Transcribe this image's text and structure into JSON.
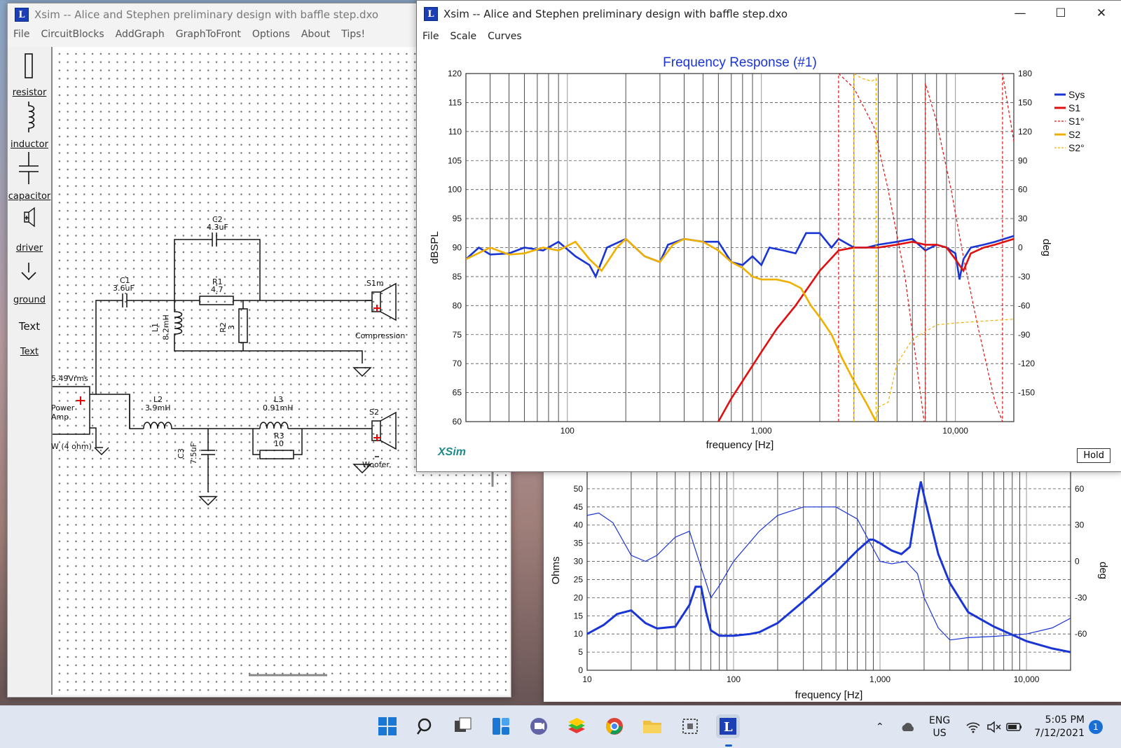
{
  "circuit_window": {
    "title": "Xsim -- Alice and Stephen preliminary design with baffle step.dxo",
    "menu": [
      "File",
      "CircuitBlocks",
      "AddGraph",
      "GraphToFront",
      "Options",
      "About",
      "Tips!"
    ],
    "palette": [
      "resistor",
      "inductor",
      "capacitor",
      "driver",
      "ground",
      "Text",
      "Text"
    ],
    "components": {
      "c1": [
        "C1",
        "3.6uF"
      ],
      "c2": [
        "C2",
        "4.3uF"
      ],
      "r1": [
        "R1",
        "4.7"
      ],
      "r2": [
        "R2",
        "3"
      ],
      "l1": [
        "L1",
        "8.2mH"
      ],
      "l2": [
        "L2",
        "3.9mH"
      ],
      "l3": [
        "L3",
        "0.91mH"
      ],
      "r3": [
        "R3",
        "10"
      ],
      "c3": [
        "C3",
        "7.5uF"
      ],
      "s1": [
        "S1m",
        "Compression"
      ],
      "s2": [
        "S2",
        "Woofer"
      ],
      "amp": [
        "5.49Vrms",
        "Power",
        "Amp.",
        "W (4 ohm)"
      ]
    }
  },
  "graph_window": {
    "title": "Xsim -- Alice and Stephen preliminary design with baffle step.dxo",
    "menu": [
      "File",
      "Scale",
      "Curves"
    ],
    "brand": "XSim",
    "hold": "Hold"
  },
  "chart_data": [
    {
      "type": "line",
      "title": "Frequency Response (#1)",
      "xlabel": "frequency [Hz]",
      "ylabel": "dBSPL",
      "y2label": "deg",
      "xscale": "log",
      "xlim": [
        30,
        20000
      ],
      "ylim": [
        60,
        120
      ],
      "y2lim": [
        -180,
        180
      ],
      "x_ticks": [
        "100",
        "1,000",
        "10,000"
      ],
      "y_ticks": [
        "120",
        "115",
        "110",
        "105",
        "100",
        "95",
        "90",
        "85",
        "80",
        "75",
        "70",
        "65",
        "60"
      ],
      "y2_ticks": [
        "180",
        "150",
        "120",
        "90",
        "60",
        "30",
        "0",
        "-30",
        "-60",
        "-90",
        "-120",
        "-150"
      ],
      "grid": true,
      "legend_position": "right",
      "series": [
        {
          "name": "Sys",
          "color": "#1a35d6",
          "dash": false,
          "axis": "left",
          "x": [
            30,
            35,
            40,
            50,
            60,
            75,
            90,
            110,
            130,
            140,
            160,
            200,
            250,
            300,
            330,
            400,
            500,
            600,
            700,
            800,
            900,
            1000,
            1100,
            1300,
            1500,
            1700,
            2000,
            2300,
            2500,
            3000,
            3500,
            4000,
            5000,
            6000,
            7000,
            8000,
            9000,
            10000,
            10500,
            11000,
            12000,
            14000,
            16000,
            20000
          ],
          "y": [
            88,
            90,
            88.8,
            89,
            90,
            89.5,
            91,
            88.5,
            87,
            85,
            90,
            91.5,
            88.5,
            87.5,
            90.5,
            91.5,
            91,
            91,
            87.5,
            87,
            88.5,
            87,
            90,
            89.5,
            89,
            92.5,
            92.5,
            90,
            91.5,
            90,
            90,
            90.5,
            91,
            91.5,
            89.5,
            90.5,
            90,
            89,
            84.5,
            88,
            90,
            90.5,
            91,
            92
          ]
        },
        {
          "name": "S1",
          "color": "#e01010",
          "dash": false,
          "axis": "left",
          "x": [
            600,
            700,
            800,
            1000,
            1200,
            1500,
            2000,
            2500,
            3000,
            4000,
            5000,
            6000,
            7000,
            8000,
            9000,
            10000,
            11000,
            12000,
            14000,
            16000,
            20000
          ],
          "y": [
            60,
            64,
            67,
            72,
            76,
            80,
            86,
            89.5,
            90,
            90,
            90.5,
            91,
            90.5,
            90.5,
            90,
            88,
            86,
            89,
            90,
            90.5,
            91.5
          ]
        },
        {
          "name": "S1°",
          "color": "#e01010",
          "dash": true,
          "axis": "right",
          "x": [
            2500,
            2500,
            3000,
            3800,
            4500,
            5500,
            6500,
            6900,
            7000,
            7000,
            8000,
            9500,
            11000,
            13000,
            16000,
            17500,
            17500,
            20000
          ],
          "y": [
            -180,
            180,
            165,
            125,
            60,
            -30,
            -140,
            -180,
            -180,
            170,
            130,
            60,
            -10,
            -80,
            -160,
            -180,
            180,
            110
          ]
        },
        {
          "name": "S2",
          "color": "#f0b000",
          "dash": false,
          "axis": "left",
          "x": [
            30,
            40,
            50,
            60,
            75,
            90,
            110,
            130,
            150,
            180,
            200,
            250,
            300,
            350,
            400,
            500,
            600,
            700,
            800,
            900,
            1000,
            1200,
            1400,
            1600,
            1800,
            2000,
            2300,
            2600,
            3000,
            3500,
            3900
          ],
          "y": [
            88,
            90,
            88.8,
            89,
            90,
            89.5,
            91,
            88,
            86,
            90,
            91.5,
            88.5,
            87.5,
            90.5,
            91.5,
            91,
            89.5,
            87.5,
            86.5,
            85,
            84.5,
            84.5,
            84,
            83,
            80,
            78,
            75,
            71,
            67,
            63,
            60
          ]
        },
        {
          "name": "S2°",
          "color": "#f0b000",
          "dash": true,
          "axis": "right",
          "x": [
            3000,
            3000,
            3300,
            3700,
            3900,
            3900,
            4000,
            4500,
            5000,
            6000,
            8000,
            10000,
            14000,
            20000
          ],
          "y": [
            -180,
            180,
            175,
            172,
            175,
            -180,
            -165,
            -160,
            -120,
            -95,
            -80,
            -78,
            -76,
            -74
          ]
        }
      ]
    },
    {
      "type": "line",
      "title": "",
      "xlabel": "frequency [Hz]",
      "ylabel": "Ohms",
      "y2label": "deg",
      "xscale": "log",
      "xlim": [
        10,
        20000
      ],
      "ylim": [
        0,
        55
      ],
      "y2lim": [
        -90,
        75
      ],
      "x_ticks": [
        "10",
        "100",
        "1,000",
        "10,000"
      ],
      "y_ticks": [
        "50",
        "45",
        "40",
        "35",
        "30",
        "25",
        "20",
        "15",
        "10",
        "5",
        "0"
      ],
      "y2_ticks": [
        "60",
        "30",
        "0",
        "-30",
        "-60"
      ],
      "grid": true,
      "series": [
        {
          "name": "impedance",
          "color": "#1a35d6",
          "width": 3,
          "axis": "left",
          "x": [
            10,
            13,
            16,
            20,
            25,
            30,
            40,
            50,
            55,
            60,
            65,
            70,
            80,
            100,
            130,
            150,
            200,
            300,
            500,
            700,
            850,
            900,
            1000,
            1200,
            1400,
            1600,
            1800,
            1900,
            2000,
            2500,
            3000,
            4000,
            6000,
            10000,
            15000,
            20000
          ],
          "y": [
            10,
            12.5,
            15.5,
            16.5,
            13,
            11.5,
            12,
            18,
            23,
            23,
            16,
            11,
            9.5,
            9.5,
            10,
            10.5,
            13,
            19,
            27,
            33,
            36,
            36,
            35,
            33,
            32,
            34,
            47,
            52,
            48,
            32,
            24,
            16,
            12,
            8,
            6,
            5
          ]
        },
        {
          "name": "phase",
          "color": "#1a35d6",
          "width": 1.2,
          "axis": "right",
          "x": [
            10,
            12,
            15,
            20,
            25,
            30,
            40,
            50,
            60,
            70,
            80,
            100,
            150,
            200,
            300,
            500,
            700,
            1000,
            1200,
            1500,
            1800,
            2000,
            2500,
            3000,
            4000,
            6000,
            10000,
            15000,
            20000
          ],
          "y": [
            38,
            40,
            32,
            5,
            0,
            5,
            20,
            25,
            -5,
            -30,
            -20,
            0,
            25,
            38,
            45,
            45,
            35,
            0,
            -2,
            0,
            -10,
            -30,
            -55,
            -65,
            -63,
            -62,
            -60,
            -55,
            -47
          ]
        }
      ]
    }
  ],
  "taskbar": {
    "lang": "ENG",
    "region": "US",
    "time": "5:05 PM",
    "date": "7/12/2021",
    "badge": "1"
  }
}
